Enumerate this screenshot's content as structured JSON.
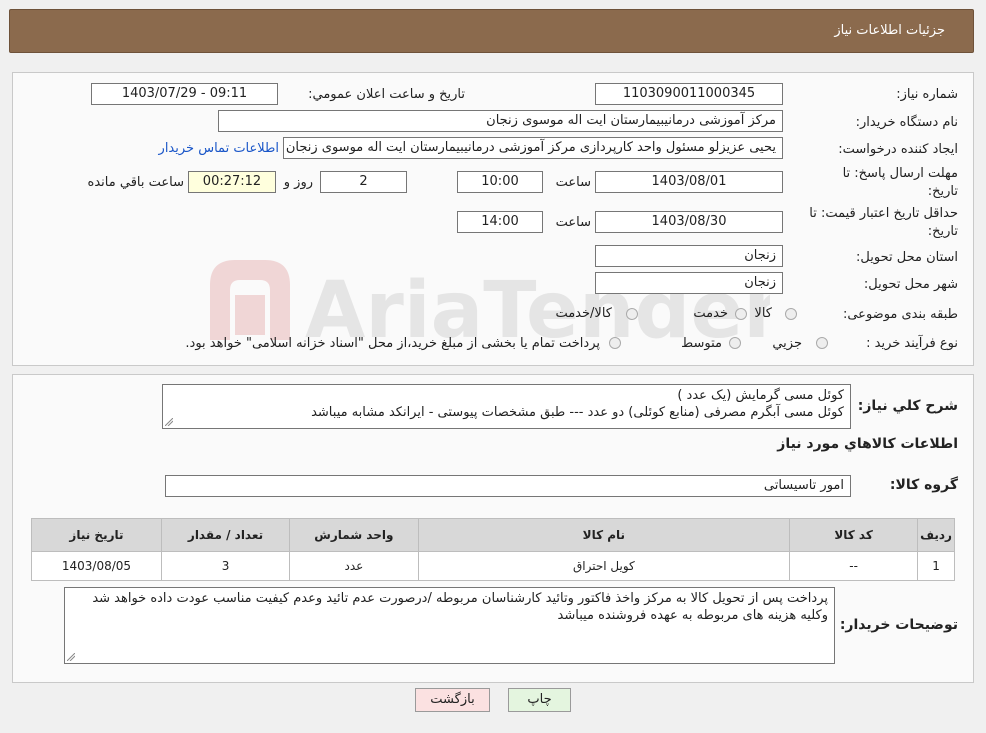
{
  "header": {
    "title": "جزئیات اطلاعات نیاز"
  },
  "info": {
    "need_number_label": "شماره نیاز:",
    "need_number": "1103090011000345",
    "announce_label": "تاریخ و ساعت اعلان عمومي:",
    "announce_value": "1403/07/29 - 09:11",
    "buyer_label": "نام دستگاه خريدار:",
    "buyer_value": "مرکز آموزشی درمانیبیمارستان ایت اله موسوی زنجان",
    "creator_label": "ايجاد کننده درخواست:",
    "creator_value": "یحیی عزیزلو مسئول واحد کارپردازی مرکز آموزشی درمانیبیمارستان ایت اله موسوی زنجان",
    "contact_link": "اطلاعات تماس خريدار",
    "deadline_label_1": "مهلت ارسال پاسخ: تا",
    "deadline_label_2": "تاریخ:",
    "deadline_date": "1403/08/01",
    "time_label": "ساعت",
    "deadline_time": "10:00",
    "days_value": "2",
    "days_label": "روز و",
    "remain_value": "00:27:12",
    "remain_label": "ساعت باقي مانده",
    "validity_label_1": "حداقل تاریخ اعتبار قیمت: تا",
    "validity_label_2": "تاریخ:",
    "validity_date": "1403/08/30",
    "validity_time": "14:00",
    "province_label": "استان محل تحويل:",
    "province_value": "زنجان",
    "city_label": "شهر محل تحويل:",
    "city_value": "زنجان",
    "category_label": "طبقه بندی موضوعی:",
    "category_options": [
      "کالا",
      "خدمت",
      "کالا/خدمت"
    ],
    "process_label": "نوع فرآيند خريد :",
    "process_options": [
      "جزيي",
      "متوسط"
    ],
    "process_note": "پرداخت تمام يا بخشی از مبلغ خريد،از محل \"اسناد خزانه اسلامی\" خواهد بود."
  },
  "watermark": {
    "text": "AriaTender.neT"
  },
  "details": {
    "summary_label": "شرح کلي نياز:",
    "summary_line1": "کوئل مسی گرمایش (یک عدد )",
    "summary_line2": "کوئل مسی آبگرم مصرفی (منابع کوئلی) دو عدد --- طبق مشخصات پیوستی - ایرانکد مشابه میباشد",
    "goods_heading": "اطلاعات کالاهاي مورد نياز",
    "group_label": "گروه کالا:",
    "group_value": "امور تاسیساتی",
    "table": {
      "headers": [
        "رديف",
        "کد کالا",
        "نام کالا",
        "واحد شمارش",
        "تعداد / مقدار",
        "تاریخ نیاز"
      ],
      "rows": [
        [
          "1",
          "--",
          "کویل احتراق",
          "عدد",
          "3",
          "1403/08/05"
        ]
      ]
    },
    "notes_label": "توضيحات خريدار:",
    "notes_value": "پرداخت پس از تحویل کالا به مرکز واخذ فاکتور وتائید کارشناسان مربوطه /درصورت عدم تائید وعدم کیفیت مناسب عودت داده خواهد شد وکلیه هزینه های مربوطه به عهده فروشنده میباشد"
  },
  "buttons": {
    "print": "چاپ",
    "back": "بازگشت"
  },
  "colors": {
    "header_bg": "#8b6a4d",
    "back_btn_bg": "#fbe1e1",
    "print_btn_bg": "#e4f5df",
    "link": "#1a56c8"
  }
}
